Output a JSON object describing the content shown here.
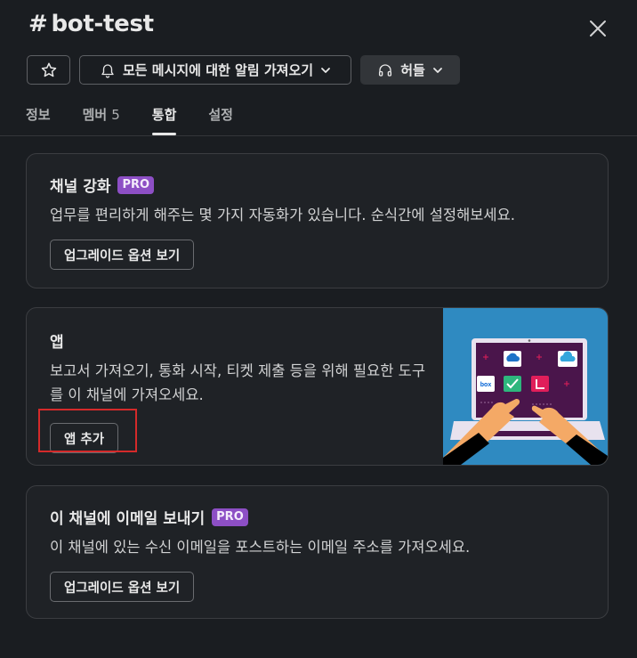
{
  "header": {
    "hash": "#",
    "channel_name": "bot-test"
  },
  "toolbar": {
    "notify_label": "모든 메시지에 대한 알림 가져오기",
    "huddle_label": "허들"
  },
  "tabs": [
    {
      "label": "정보"
    },
    {
      "label": "멤버",
      "count": "5"
    },
    {
      "label": "통합"
    },
    {
      "label": "설정"
    }
  ],
  "cards": {
    "enhance": {
      "title": "채널 강화",
      "badge": "PRO",
      "description": "업무를 편리하게 해주는 몇 가지 자동화가 있습니다. 순식간에 설정해보세요.",
      "button": "업그레이드 옵션 보기"
    },
    "apps": {
      "title": "앱",
      "description": "보고서 가져오기, 통화 시작, 티켓 제출 등을 위해 필요한 도구를 이 채널에 가져오세요.",
      "button": "앱 추가",
      "illus_box_label": "box"
    },
    "email": {
      "title": "이 채널에 이메일 보내기",
      "badge": "PRO",
      "description": "이 채널에 있는 수신 이메일을 포스트하는 이메일 주소를 가져오세요.",
      "button": "업그레이드 옵션 보기"
    }
  },
  "colors": {
    "background": "#1a1d21",
    "card": "#1f2226",
    "pro_badge": "#8d4fc5",
    "illustration_bg": "#2f8ac1",
    "highlight": "#d42a2a"
  }
}
